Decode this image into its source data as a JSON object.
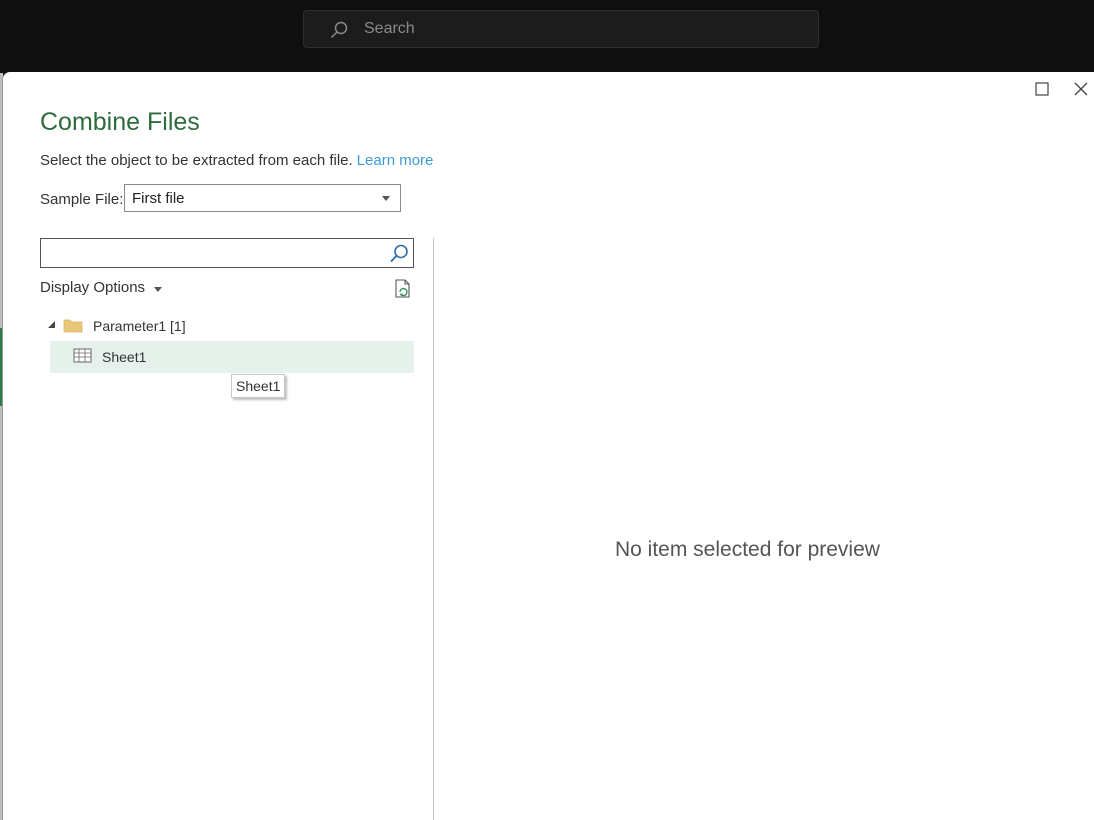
{
  "app": {
    "search_placeholder": "Search"
  },
  "dialog": {
    "title": "Combine Files",
    "subtitle": "Select the object to be extracted from each file.",
    "learn_more": "Learn more",
    "sample_file": {
      "label": "Sample File:",
      "value": "First file"
    },
    "filter": {
      "value": "",
      "placeholder": ""
    },
    "display_options_label": "Display Options",
    "tree": {
      "folder": {
        "label": "Parameter1 [1]",
        "icon": "folder-icon"
      },
      "items": [
        {
          "label": "Sheet1",
          "icon": "table-icon",
          "selected": false,
          "hovered": true
        }
      ]
    },
    "tooltip": "Sheet1",
    "preview_message": "No item selected for preview"
  },
  "colors": {
    "title_green": "#2e6b3e",
    "link_blue": "#3d9bd6",
    "hover_bg": "#e6f1ec",
    "folder_yellow": "#e8c77a"
  }
}
